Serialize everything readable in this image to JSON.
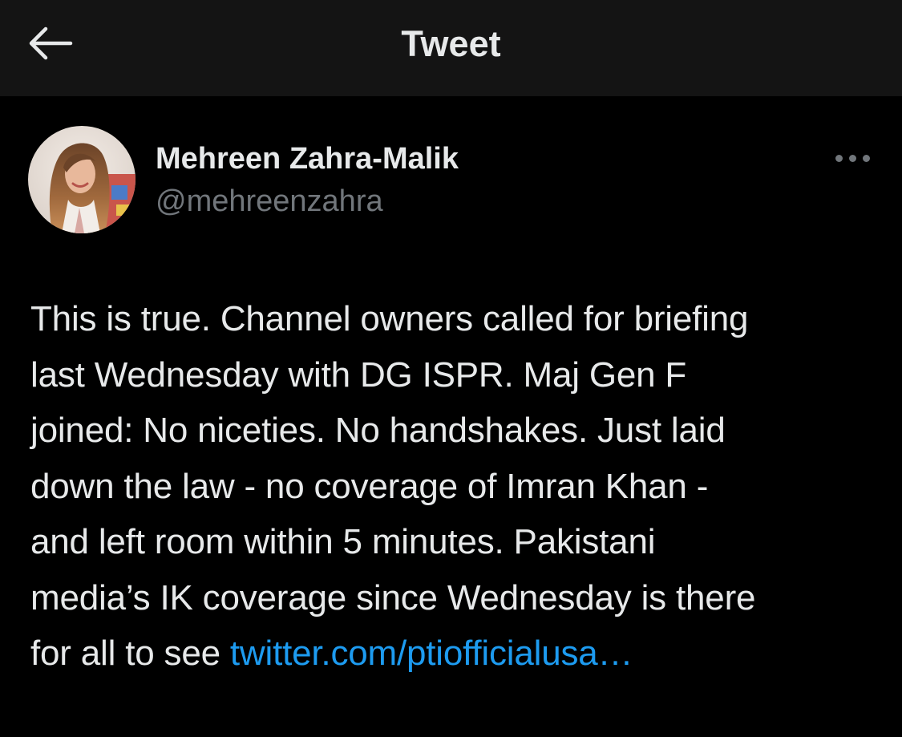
{
  "header": {
    "title": "Tweet",
    "back_icon": "arrow-left-icon"
  },
  "author": {
    "display_name": "Mehreen Zahra-Malik",
    "handle": "@mehreenzahra",
    "avatar_icon": "avatar-photo",
    "more_icon": "more-horizontal-icon"
  },
  "tweet": {
    "lines": [
      "This is true. Channel owners called for briefing",
      "last Wednesday with DG ISPR. Maj Gen F",
      "joined: No niceties. No handshakes. Just laid",
      "down the law - no coverage of Imran Khan -",
      "and left room within 5 minutes. Pakistani",
      "media’s IK coverage since Wednesday is there",
      "for all to see "
    ],
    "link_text": "twitter.com/ptiofficialusa…"
  },
  "colors": {
    "background": "#000000",
    "header_background": "#141414",
    "primary_text": "#e7e9ea",
    "secondary_text": "#71767b",
    "link": "#1d9bf0"
  }
}
